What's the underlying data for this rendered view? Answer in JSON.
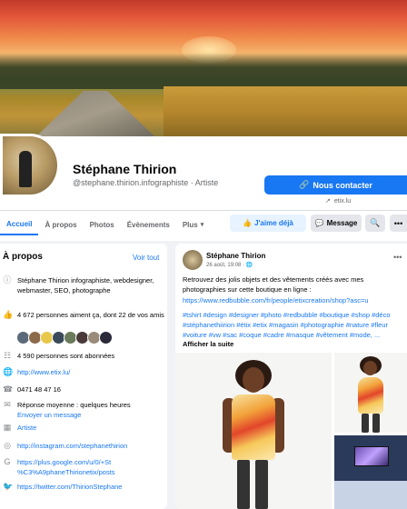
{
  "profile": {
    "name": "Stéphane Thirion",
    "handle": "@stephane.thirion.infographiste · Artiste",
    "contact_button": "Nous contacter",
    "website_short": "etix.lu"
  },
  "tabs": [
    {
      "label": "Accueil",
      "active": true
    },
    {
      "label": "À propos"
    },
    {
      "label": "Photos"
    },
    {
      "label": "Évènements"
    },
    {
      "label": "Plus"
    }
  ],
  "actions": {
    "like": "J'aime déjà",
    "message": "Message"
  },
  "about": {
    "title": "À propos",
    "see_all": "Voir tout",
    "description": "Stéphane Thirion infographiste, webdesigner, webmaster, SEO, photographe",
    "likes": "4 672 personnes aiment ça, dont 22 de vos amis",
    "followers": "4 590 personnes sont abonnées",
    "website": "http://www.etix.lu/",
    "phone": "0471 48 47 16",
    "response": "Réponse moyenne : quelques heures",
    "send_message": "Envoyer un message",
    "category": "Artiste",
    "instagram": "http://instagram.com/stephanethirion",
    "google": "https://plus.google.com/u/0/+St %C3%A9phaneThirionetix/posts",
    "twitter": "https://twitter.com/ThirionStephane"
  },
  "post": {
    "author": "Stéphane Thirion",
    "date": "26 août, 19:08 · 🌐",
    "text": "Retrouvez des jolis objets et des vêtements créés avec mes photographies sur cette boutique en ligne :",
    "link": "https://www.redbubble.com/fr/people/etixcreation/shop?asc=u",
    "tags": "#tshirt #design #designer #photo #redbubble #boutique #shop #déco #stéphanethiirion #étix #etix #magasin #photographie #nature #fleur #voiture #vw #sac #coque #cadre #masque #vêtement #mode, ...",
    "see_more": "Afficher la suite"
  },
  "colors": {
    "accent": "#1877f2",
    "background": "#f0f2f5"
  },
  "icons": [
    "link-icon",
    "external-link-icon",
    "like-icon",
    "messenger-icon",
    "search-icon",
    "more-icon",
    "info-icon",
    "thumb-icon",
    "follow-icon",
    "globe-icon",
    "phone-icon",
    "chat-icon",
    "tag-icon",
    "instagram-icon",
    "google-icon",
    "twitter-icon"
  ]
}
